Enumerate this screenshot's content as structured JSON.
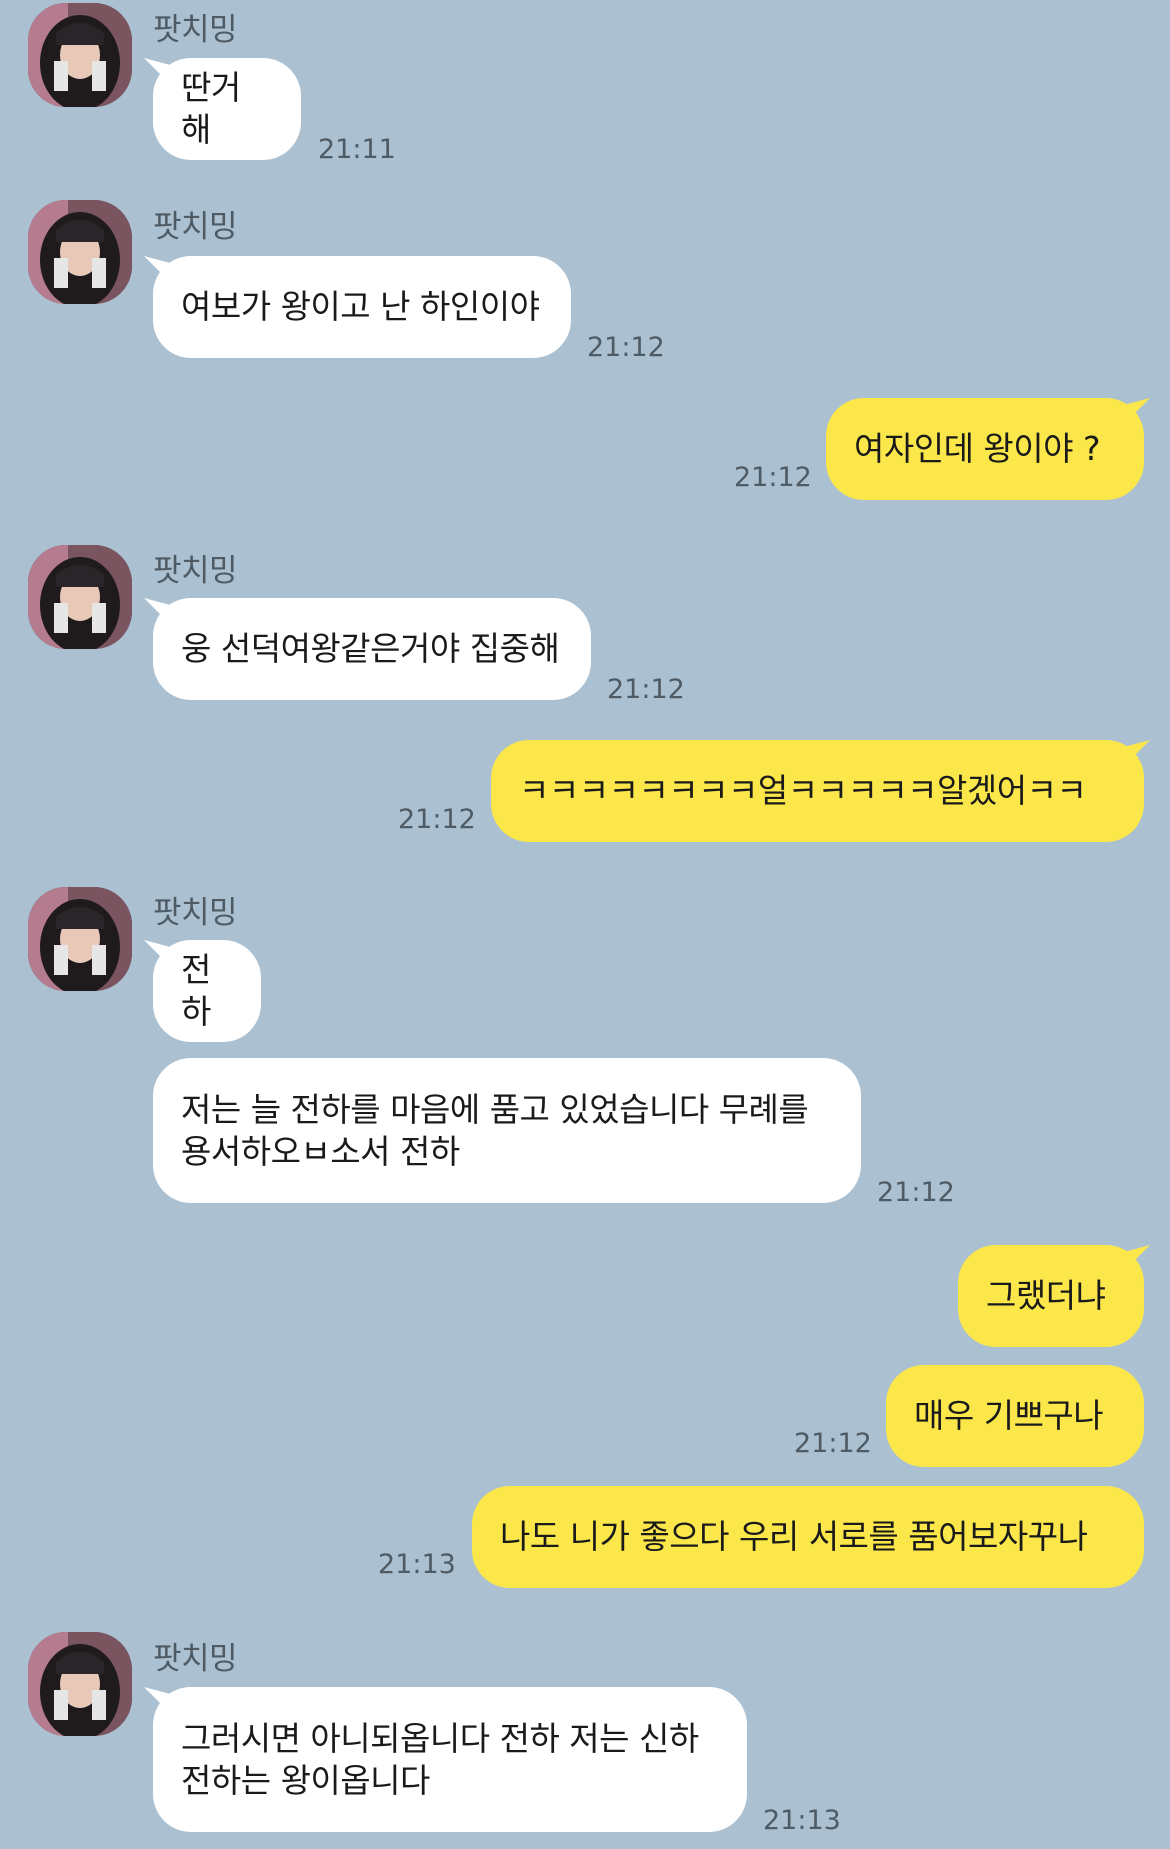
{
  "contact": {
    "name": "팟치밍"
  },
  "messages": [
    {
      "from": "them",
      "show_sender": true,
      "text": "딴거 해",
      "time": "21:11"
    },
    {
      "from": "them",
      "show_sender": true,
      "text": "여보가 왕이고 난 하인이야",
      "time": "21:12"
    },
    {
      "from": "me",
      "text": "여자인데 왕이야 ?",
      "time": "21:12"
    },
    {
      "from": "them",
      "show_sender": true,
      "text": "웅 선덕여왕같은거야 집중해",
      "time": "21:12"
    },
    {
      "from": "me",
      "text": "ㅋㅋㅋㅋㅋㅋㅋㅋ얼ㅋㅋㅋㅋㅋ알겠어ㅋㅋ",
      "time": "21:12"
    },
    {
      "from": "them",
      "show_sender": true,
      "text": "전하",
      "time": ""
    },
    {
      "from": "them",
      "show_sender": false,
      "text": "저는 늘 전하를 마음에 품고 있었습니다 무례를\n용서하오ㅂ소서 전하",
      "time": "21:12"
    },
    {
      "from": "me",
      "text": "그랬더냐",
      "time": ""
    },
    {
      "from": "me",
      "text": "매우 기쁘구나",
      "time": "21:12"
    },
    {
      "from": "me",
      "text": "나도 니가 좋으다 우리 서로를 품어보자꾸나",
      "time": "21:13"
    },
    {
      "from": "them",
      "show_sender": true,
      "text": "그러시면 아니되옵니다 전하 저는 신하\n전하는 왕이옵니다",
      "time": "21:13"
    }
  ],
  "colors": {
    "background": "#abc1d1",
    "incoming_bubble": "#ffffff",
    "outgoing_bubble": "#fbe74a",
    "timestamp": "#4e5a64"
  }
}
